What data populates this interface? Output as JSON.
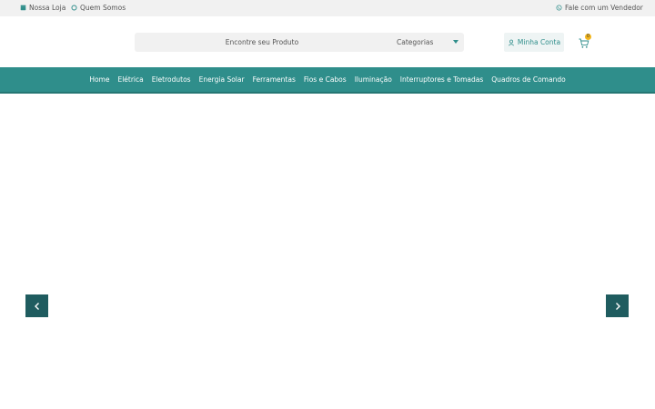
{
  "topbar": {
    "store_label": "Nossa Loja",
    "store_icon": "store-icon",
    "about_label": "Quem Somos",
    "about_icon": "circle-icon",
    "seller_label": "Fale com um Vendedor",
    "seller_icon": "whatsapp-icon"
  },
  "header": {
    "search": {
      "placeholder": "Encontre seu Produto",
      "value": ""
    },
    "category_select": {
      "selected": "Categorias"
    },
    "account_label": "Minha Conta",
    "account_icon": "user-icon",
    "cart_icon": "cart-icon",
    "cart_count": "0"
  },
  "nav": {
    "items": [
      {
        "label": "Home"
      },
      {
        "label": "Elétrica"
      },
      {
        "label": "Eletrodutos"
      },
      {
        "label": "Energia Solar"
      },
      {
        "label": "Ferramentas"
      },
      {
        "label": "Fios e Cabos"
      },
      {
        "label": "Iluminação"
      },
      {
        "label": "Interruptores e Tomadas"
      },
      {
        "label": "Quadros de Comando"
      }
    ]
  },
  "slider": {
    "prev_icon": "chevron-left-icon",
    "next_icon": "chevron-right-icon"
  },
  "colors": {
    "brand_teal": "#2f8e8b",
    "arrow_bg": "#1f5c5f",
    "topbar_bg": "#f1f1f1",
    "badge": "#f2b51c"
  }
}
